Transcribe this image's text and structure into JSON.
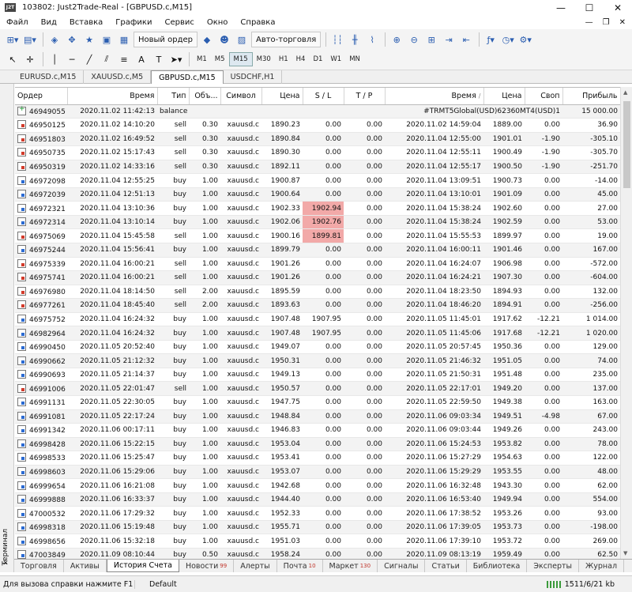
{
  "window": {
    "title": "103802: Just2Trade-Real - [GBPUSD.c,M15]"
  },
  "menu": [
    "Файл",
    "Вид",
    "Вставка",
    "Графики",
    "Сервис",
    "Окно",
    "Справка"
  ],
  "toolbar": {
    "new_order": "Новый ордер",
    "autotrading": "Авто-торговля"
  },
  "timeframes": [
    "M1",
    "M5",
    "M15",
    "M30",
    "H1",
    "H4",
    "D1",
    "W1",
    "MN"
  ],
  "active_timeframe": "M15",
  "chart_tabs": [
    "EURUSD.c,M15",
    "XAUUSD.c,M5",
    "GBPUSD.c,M15",
    "USDCHF,H1"
  ],
  "active_chart_tab": "GBPUSD.c,M15",
  "columns": [
    "Ордер",
    "Время",
    "Тип",
    "Объ...",
    "Символ",
    "Цена",
    "S / L",
    "T / P",
    "Время",
    "Цена",
    "Своп",
    "Прибыль"
  ],
  "balance_row": {
    "order": "46949055",
    "time": "2020.11.02 11:42:13",
    "type": "balance",
    "comment": "#TRMT5Global(USD)62360MT4(USD)1",
    "profit": "15 000.00"
  },
  "rows": [
    {
      "o": "46950125",
      "t1": "2020.11.02 14:10:20",
      "type": "sell",
      "vol": "0.30",
      "sym": "xauusd.c",
      "p1": "1890.23",
      "sl": "0.00",
      "tp": "0.00",
      "t2": "2020.11.02 14:59:04",
      "p2": "1889.00",
      "swap": "0.00",
      "pr": "36.90"
    },
    {
      "o": "46951803",
      "t1": "2020.11.02 16:49:52",
      "type": "sell",
      "vol": "0.30",
      "sym": "xauusd.c",
      "p1": "1890.84",
      "sl": "0.00",
      "tp": "0.00",
      "t2": "2020.11.04 12:55:00",
      "p2": "1901.01",
      "swap": "-1.90",
      "pr": "-305.10"
    },
    {
      "o": "46950735",
      "t1": "2020.11.02 15:17:43",
      "type": "sell",
      "vol": "0.30",
      "sym": "xauusd.c",
      "p1": "1890.30",
      "sl": "0.00",
      "tp": "0.00",
      "t2": "2020.11.04 12:55:11",
      "p2": "1900.49",
      "swap": "-1.90",
      "pr": "-305.70"
    },
    {
      "o": "46950319",
      "t1": "2020.11.02 14:33:16",
      "type": "sell",
      "vol": "0.30",
      "sym": "xauusd.c",
      "p1": "1892.11",
      "sl": "0.00",
      "tp": "0.00",
      "t2": "2020.11.04 12:55:17",
      "p2": "1900.50",
      "swap": "-1.90",
      "pr": "-251.70"
    },
    {
      "o": "46972098",
      "t1": "2020.11.04 12:55:25",
      "type": "buy",
      "vol": "1.00",
      "sym": "xauusd.c",
      "p1": "1900.87",
      "sl": "0.00",
      "tp": "0.00",
      "t2": "2020.11.04 13:09:51",
      "p2": "1900.73",
      "swap": "0.00",
      "pr": "-14.00"
    },
    {
      "o": "46972039",
      "t1": "2020.11.04 12:51:13",
      "type": "buy",
      "vol": "1.00",
      "sym": "xauusd.c",
      "p1": "1900.64",
      "sl": "0.00",
      "tp": "0.00",
      "t2": "2020.11.04 13:10:01",
      "p2": "1901.09",
      "swap": "0.00",
      "pr": "45.00"
    },
    {
      "o": "46972321",
      "t1": "2020.11.04 13:10:36",
      "type": "buy",
      "vol": "1.00",
      "sym": "xauusd.c",
      "p1": "1902.33",
      "sl": "1902.94",
      "tp": "0.00",
      "t2": "2020.11.04 15:38:24",
      "p2": "1902.60",
      "swap": "0.00",
      "pr": "27.00",
      "hl": true
    },
    {
      "o": "46972314",
      "t1": "2020.11.04 13:10:14",
      "type": "buy",
      "vol": "1.00",
      "sym": "xauusd.c",
      "p1": "1902.06",
      "sl": "1902.76",
      "tp": "0.00",
      "t2": "2020.11.04 15:38:24",
      "p2": "1902.59",
      "swap": "0.00",
      "pr": "53.00",
      "hl": true
    },
    {
      "o": "46975069",
      "t1": "2020.11.04 15:45:58",
      "type": "sell",
      "vol": "1.00",
      "sym": "xauusd.c",
      "p1": "1900.16",
      "sl": "1899.81",
      "tp": "0.00",
      "t2": "2020.11.04 15:55:53",
      "p2": "1899.97",
      "swap": "0.00",
      "pr": "19.00",
      "hl": true
    },
    {
      "o": "46975244",
      "t1": "2020.11.04 15:56:41",
      "type": "buy",
      "vol": "1.00",
      "sym": "xauusd.c",
      "p1": "1899.79",
      "sl": "0.00",
      "tp": "0.00",
      "t2": "2020.11.04 16:00:11",
      "p2": "1901.46",
      "swap": "0.00",
      "pr": "167.00"
    },
    {
      "o": "46975339",
      "t1": "2020.11.04 16:00:21",
      "type": "sell",
      "vol": "1.00",
      "sym": "xauusd.c",
      "p1": "1901.26",
      "sl": "0.00",
      "tp": "0.00",
      "t2": "2020.11.04 16:24:07",
      "p2": "1906.98",
      "swap": "0.00",
      "pr": "-572.00"
    },
    {
      "o": "46975741",
      "t1": "2020.11.04 16:00:21",
      "type": "sell",
      "vol": "1.00",
      "sym": "xauusd.c",
      "p1": "1901.26",
      "sl": "0.00",
      "tp": "0.00",
      "t2": "2020.11.04 16:24:21",
      "p2": "1907.30",
      "swap": "0.00",
      "pr": "-604.00"
    },
    {
      "o": "46976980",
      "t1": "2020.11.04 18:14:50",
      "type": "sell",
      "vol": "2.00",
      "sym": "xauusd.c",
      "p1": "1895.59",
      "sl": "0.00",
      "tp": "0.00",
      "t2": "2020.11.04 18:23:50",
      "p2": "1894.93",
      "swap": "0.00",
      "pr": "132.00"
    },
    {
      "o": "46977261",
      "t1": "2020.11.04 18:45:40",
      "type": "sell",
      "vol": "2.00",
      "sym": "xauusd.c",
      "p1": "1893.63",
      "sl": "0.00",
      "tp": "0.00",
      "t2": "2020.11.04 18:46:20",
      "p2": "1894.91",
      "swap": "0.00",
      "pr": "-256.00"
    },
    {
      "o": "46975752",
      "t1": "2020.11.04 16:24:32",
      "type": "buy",
      "vol": "1.00",
      "sym": "xauusd.c",
      "p1": "1907.48",
      "sl": "1907.95",
      "tp": "0.00",
      "t2": "2020.11.05 11:45:01",
      "p2": "1917.62",
      "swap": "-12.21",
      "pr": "1 014.00"
    },
    {
      "o": "46982964",
      "t1": "2020.11.04 16:24:32",
      "type": "buy",
      "vol": "1.00",
      "sym": "xauusd.c",
      "p1": "1907.48",
      "sl": "1907.95",
      "tp": "0.00",
      "t2": "2020.11.05 11:45:06",
      "p2": "1917.68",
      "swap": "-12.21",
      "pr": "1 020.00"
    },
    {
      "o": "46990450",
      "t1": "2020.11.05 20:52:40",
      "type": "buy",
      "vol": "1.00",
      "sym": "xauusd.c",
      "p1": "1949.07",
      "sl": "0.00",
      "tp": "0.00",
      "t2": "2020.11.05 20:57:45",
      "p2": "1950.36",
      "swap": "0.00",
      "pr": "129.00"
    },
    {
      "o": "46990662",
      "t1": "2020.11.05 21:12:32",
      "type": "buy",
      "vol": "1.00",
      "sym": "xauusd.c",
      "p1": "1950.31",
      "sl": "0.00",
      "tp": "0.00",
      "t2": "2020.11.05 21:46:32",
      "p2": "1951.05",
      "swap": "0.00",
      "pr": "74.00"
    },
    {
      "o": "46990693",
      "t1": "2020.11.05 21:14:37",
      "type": "buy",
      "vol": "1.00",
      "sym": "xauusd.c",
      "p1": "1949.13",
      "sl": "0.00",
      "tp": "0.00",
      "t2": "2020.11.05 21:50:31",
      "p2": "1951.48",
      "swap": "0.00",
      "pr": "235.00"
    },
    {
      "o": "46991006",
      "t1": "2020.11.05 22:01:47",
      "type": "sell",
      "vol": "1.00",
      "sym": "xauusd.c",
      "p1": "1950.57",
      "sl": "0.00",
      "tp": "0.00",
      "t2": "2020.11.05 22:17:01",
      "p2": "1949.20",
      "swap": "0.00",
      "pr": "137.00"
    },
    {
      "o": "46991131",
      "t1": "2020.11.05 22:30:05",
      "type": "buy",
      "vol": "1.00",
      "sym": "xauusd.c",
      "p1": "1947.75",
      "sl": "0.00",
      "tp": "0.00",
      "t2": "2020.11.05 22:59:50",
      "p2": "1949.38",
      "swap": "0.00",
      "pr": "163.00"
    },
    {
      "o": "46991081",
      "t1": "2020.11.05 22:17:24",
      "type": "buy",
      "vol": "1.00",
      "sym": "xauusd.c",
      "p1": "1948.84",
      "sl": "0.00",
      "tp": "0.00",
      "t2": "2020.11.06 09:03:34",
      "p2": "1949.51",
      "swap": "-4.98",
      "pr": "67.00"
    },
    {
      "o": "46991342",
      "t1": "2020.11.06 00:17:11",
      "type": "buy",
      "vol": "1.00",
      "sym": "xauusd.c",
      "p1": "1946.83",
      "sl": "0.00",
      "tp": "0.00",
      "t2": "2020.11.06 09:03:44",
      "p2": "1949.26",
      "swap": "0.00",
      "pr": "243.00"
    },
    {
      "o": "46998428",
      "t1": "2020.11.06 15:22:15",
      "type": "buy",
      "vol": "1.00",
      "sym": "xauusd.c",
      "p1": "1953.04",
      "sl": "0.00",
      "tp": "0.00",
      "t2": "2020.11.06 15:24:53",
      "p2": "1953.82",
      "swap": "0.00",
      "pr": "78.00"
    },
    {
      "o": "46998533",
      "t1": "2020.11.06 15:25:47",
      "type": "buy",
      "vol": "1.00",
      "sym": "xauusd.c",
      "p1": "1953.41",
      "sl": "0.00",
      "tp": "0.00",
      "t2": "2020.11.06 15:27:29",
      "p2": "1954.63",
      "swap": "0.00",
      "pr": "122.00"
    },
    {
      "o": "46998603",
      "t1": "2020.11.06 15:29:06",
      "type": "buy",
      "vol": "1.00",
      "sym": "xauusd.c",
      "p1": "1953.07",
      "sl": "0.00",
      "tp": "0.00",
      "t2": "2020.11.06 15:29:29",
      "p2": "1953.55",
      "swap": "0.00",
      "pr": "48.00"
    },
    {
      "o": "46999654",
      "t1": "2020.11.06 16:21:08",
      "type": "buy",
      "vol": "1.00",
      "sym": "xauusd.c",
      "p1": "1942.68",
      "sl": "0.00",
      "tp": "0.00",
      "t2": "2020.11.06 16:32:48",
      "p2": "1943.30",
      "swap": "0.00",
      "pr": "62.00"
    },
    {
      "o": "46999888",
      "t1": "2020.11.06 16:33:37",
      "type": "buy",
      "vol": "1.00",
      "sym": "xauusd.c",
      "p1": "1944.40",
      "sl": "0.00",
      "tp": "0.00",
      "t2": "2020.11.06 16:53:40",
      "p2": "1949.94",
      "swap": "0.00",
      "pr": "554.00"
    },
    {
      "o": "47000532",
      "t1": "2020.11.06 17:29:32",
      "type": "buy",
      "vol": "1.00",
      "sym": "xauusd.c",
      "p1": "1952.33",
      "sl": "0.00",
      "tp": "0.00",
      "t2": "2020.11.06 17:38:52",
      "p2": "1953.26",
      "swap": "0.00",
      "pr": "93.00"
    },
    {
      "o": "46998318",
      "t1": "2020.11.06 15:19:48",
      "type": "buy",
      "vol": "1.00",
      "sym": "xauusd.c",
      "p1": "1955.71",
      "sl": "0.00",
      "tp": "0.00",
      "t2": "2020.11.06 17:39:05",
      "p2": "1953.73",
      "swap": "0.00",
      "pr": "-198.00"
    },
    {
      "o": "46998656",
      "t1": "2020.11.06 15:32:18",
      "type": "buy",
      "vol": "1.00",
      "sym": "xauusd.c",
      "p1": "1951.03",
      "sl": "0.00",
      "tp": "0.00",
      "t2": "2020.11.06 17:39:10",
      "p2": "1953.72",
      "swap": "0.00",
      "pr": "269.00"
    },
    {
      "o": "47003849",
      "t1": "2020.11.09 08:10:44",
      "type": "buy",
      "vol": "0.50",
      "sym": "xauusd.c",
      "p1": "1958.24",
      "sl": "0.00",
      "tp": "0.00",
      "t2": "2020.11.09 08:13:19",
      "p2": "1959.49",
      "swap": "0.00",
      "pr": "62.50"
    }
  ],
  "side_panel": {
    "label": "Терминал",
    "close": "×"
  },
  "bottom_tabs": [
    {
      "label": "Торговля"
    },
    {
      "label": "Активы"
    },
    {
      "label": "История Счета",
      "active": true
    },
    {
      "label": "Новости",
      "badge": "99"
    },
    {
      "label": "Алерты"
    },
    {
      "label": "Почта",
      "badge": "10"
    },
    {
      "label": "Маркет",
      "badge": "130"
    },
    {
      "label": "Сигналы"
    },
    {
      "label": "Статьи"
    },
    {
      "label": "Библиотека"
    },
    {
      "label": "Эксперты"
    },
    {
      "label": "Журнал"
    }
  ],
  "status": {
    "help": "Для вызова справки нажмите F1",
    "profile": "Default",
    "traffic": "1511/6/21 kb"
  },
  "colors": {
    "sl_highlight": "#f2a9a8",
    "badge_red": "#c0342a"
  }
}
